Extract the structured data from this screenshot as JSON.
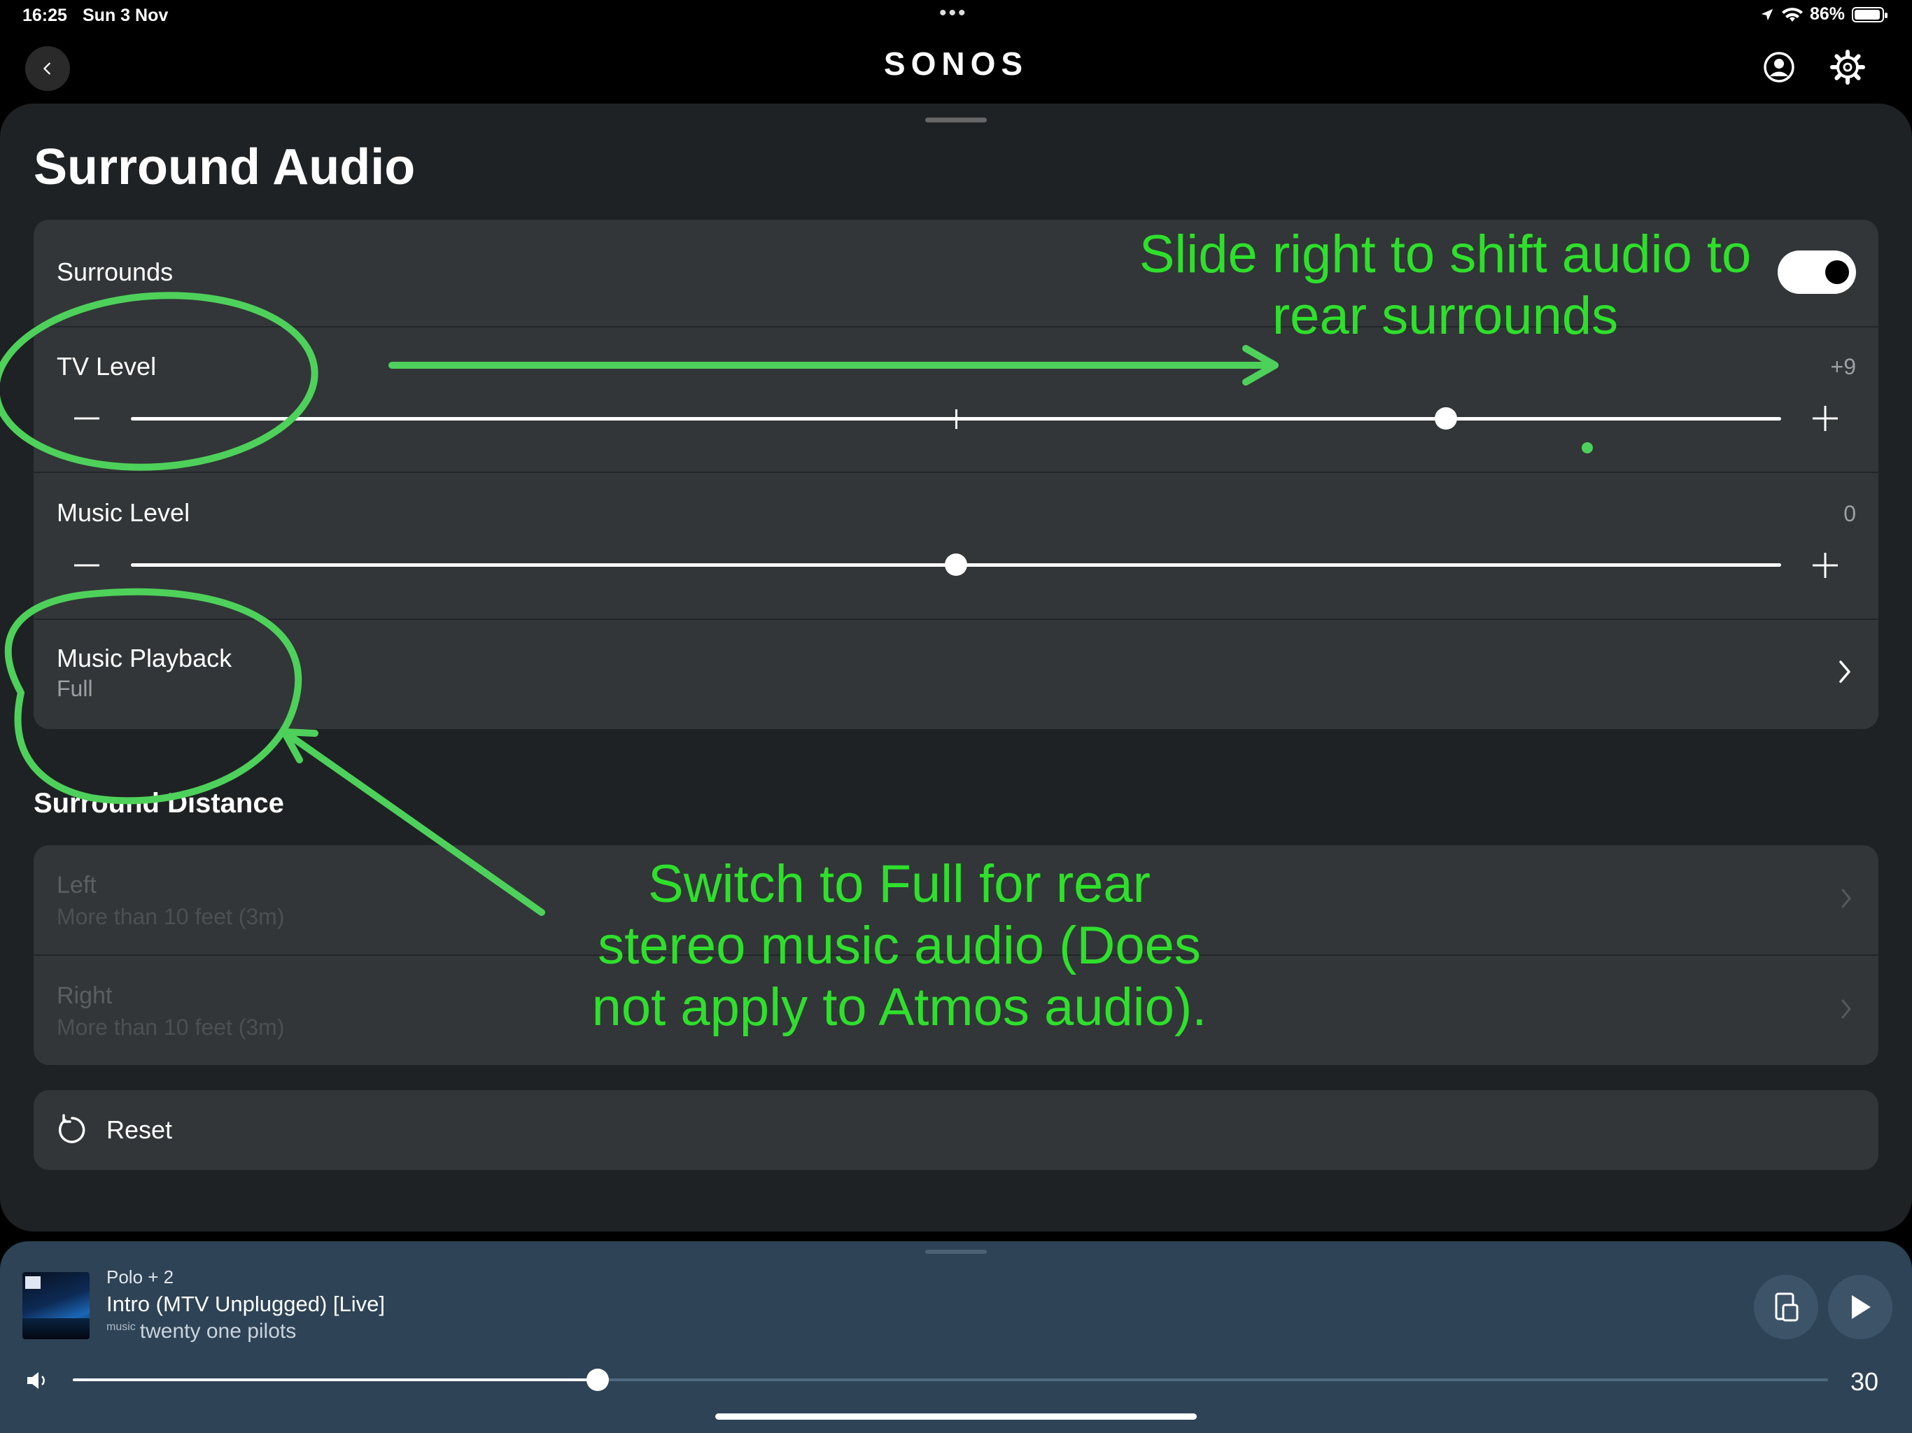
{
  "status": {
    "time": "16:25",
    "date": "Sun 3 Nov",
    "dots": "•••",
    "battery": "86%"
  },
  "header": {
    "logo": "SONOS"
  },
  "page": {
    "title": "Surround Audio"
  },
  "settings": {
    "surrounds": {
      "label": "Surrounds",
      "enabled": true
    },
    "tv_level": {
      "label": "TV Level",
      "value": "+9",
      "fraction": 0.797
    },
    "music_level": {
      "label": "Music Level",
      "value": "0",
      "fraction": 0.5
    },
    "music_playback": {
      "label": "Music Playback",
      "value": "Full"
    }
  },
  "surround_distance": {
    "title": "Surround Distance",
    "left": {
      "label": "Left",
      "value": "More than 10 feet (3m)"
    },
    "right": {
      "label": "Right",
      "value": "More than 10 feet (3m)"
    }
  },
  "reset": {
    "label": "Reset"
  },
  "annotations": {
    "top": "Slide right to shift audio to rear surrounds",
    "bottom": "Switch to Full for rear stereo music audio (Does not apply to Atmos audio).",
    "color": "#2ee02b"
  },
  "player": {
    "room": "Polo + 2",
    "title": "Intro (MTV Unplugged) [Live]",
    "service": "music",
    "artist": "twenty one pilots",
    "volume": "30",
    "volume_fraction": 0.3
  },
  "colors": {
    "sheet": "#1f2224",
    "card": "#323638",
    "player": "#2e4356"
  }
}
